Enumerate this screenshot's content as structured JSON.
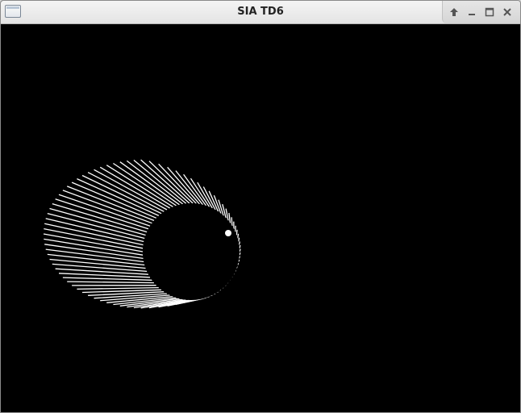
{
  "window": {
    "title": "SIA TD6"
  },
  "controls": {
    "shade_icon": "up-arrow-icon",
    "minimize_icon": "minimize-icon",
    "maximize_icon": "maximize-icon",
    "close_icon": "close-icon"
  },
  "scene": {
    "background_color": "#000000",
    "line_color": "#ffffff",
    "description_shape": "comet-like ellipse of white streaks around a dark circle",
    "streak_count": 90
  }
}
